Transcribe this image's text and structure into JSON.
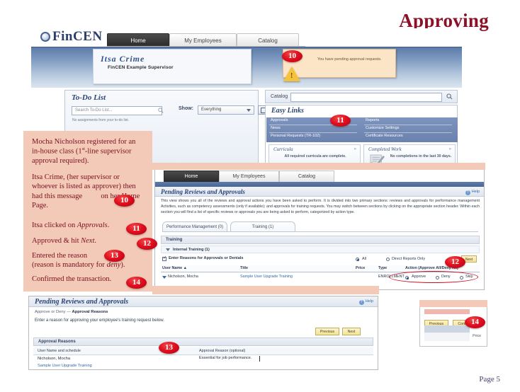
{
  "slide": {
    "title": "Approving",
    "page_label": "Page 5"
  },
  "home_screen": {
    "logo_text": "FinCEN",
    "nav_tabs": [
      {
        "label": "Home",
        "active": true
      },
      {
        "label": "My Employees",
        "active": false
      },
      {
        "label": "Catalog",
        "active": false
      }
    ],
    "user": {
      "name": "Itsa  Crime",
      "role": "FinCEN Example Supervisor"
    },
    "alert": {
      "message": "You have pending approval requests.",
      "icon": "warning-triangle-icon"
    },
    "todo": {
      "title": "To-Do List",
      "search_placeholder": "Search To-Do List...",
      "empty_text": "No assignments from your to-do list.",
      "show_label": "Show:",
      "show_value": "Everything",
      "view_buttons": [
        "list-view",
        "grid-view"
      ]
    },
    "catalog": {
      "label": "Catalog",
      "search_value": ""
    },
    "easy_links": {
      "title": "Easy Links",
      "left_column": [
        "Approvals",
        "News",
        "Personal Requests (TR-102)"
      ],
      "right_column": [
        "Reports",
        "Customize Settings",
        "Certificate Resources"
      ]
    },
    "cards": [
      {
        "title": "Curricula",
        "body": "All required curricula are complete.",
        "chevron": "»",
        "icon": null
      },
      {
        "title": "Completed Work",
        "body": "No completions in the last 30 days.",
        "chevron": "»",
        "icon": "completed-check-icon"
      }
    ]
  },
  "pending_screen": {
    "nav_tabs": [
      {
        "label": "Home",
        "active": true
      },
      {
        "label": "My Employees",
        "active": false
      },
      {
        "label": "Catalog",
        "active": false
      }
    ],
    "title": "Pending Reviews and Approvals",
    "help_label": "Help",
    "description": "This view shows you all of the reviews and approval actions you have been asked to perform. It is divided into two primary sections: reviews and approvals for performance management Activities, such as competency assessments (only if available); and approvals for training requests. You may switch between sections by clicking on the appropriate section header. Within each section you will find a list of specific reviews or approvals you are being asked to perform, categorized by action type.",
    "section_tabs": [
      {
        "label": "Performance Management (0)",
        "active": false
      },
      {
        "label": "Training (1)",
        "active": true
      }
    ],
    "training_header": "Training",
    "internal_training": "Internal Training (1)",
    "enter_reasons_label": "Enter Reasons for Approvals or Denials",
    "enter_reasons_checked": true,
    "filters": [
      {
        "label": "All",
        "selected": true
      },
      {
        "label": "Direct Reports Only",
        "selected": false
      }
    ],
    "next_button": "Next",
    "columns": [
      "User Name ▲",
      "Title",
      "Price",
      "Type",
      "Action (Approve All/Deny All)"
    ],
    "rows": [
      {
        "user_name": "Nicholson, Mocha",
        "title": "Sample User Upgrade Training",
        "price": "",
        "type": "ENROLLMENT",
        "actions": [
          {
            "label": "Approve",
            "selected": true
          },
          {
            "label": "Deny",
            "selected": false
          },
          {
            "label": "Skip",
            "selected": false
          }
        ]
      }
    ]
  },
  "reasons_screen": {
    "title": "Pending Reviews and Approvals",
    "help_label": "Help",
    "breadcrumb_prefix": "Approve or Deny — ",
    "breadcrumb_current": "Approval Reasons",
    "instruction": "Enter a reason for approving your employee's training request below.",
    "buttons": {
      "previous": "Previous",
      "next": "Next"
    },
    "section_header": "Approval Reasons",
    "columns": [
      "User Name and schedule",
      "Approval Reason (optional)"
    ],
    "row": {
      "user_name": "Nicholson, Mocha",
      "course": "Sample User Upgrade Training",
      "reason_value": "Essential for job performance."
    }
  },
  "confirm_screen": {
    "buttons": {
      "previous": "Previous",
      "confirm": "Confirm"
    },
    "price_label": "Price"
  },
  "narration": {
    "paragraphs": [
      "Mocha Nicholson registered for an in-house class (1st-line supervisor approval required).",
      "Itsa Crime, (her supervisor or whoever is listed as approver) then had this message on her Home Page.",
      "Itsa clicked on Approvals.",
      "Approved & hit Next.",
      "Entered the reason (reason is mandatory for deny).",
      "Confirmed the transaction."
    ],
    "line1a": "Mocha Nicholson registered for",
    "line1b": "an in-house class (1",
    "line1b_sup": "st",
    "line1c": "-line",
    "line1d": "supervisor approval required).",
    "line2a": "Itsa Crime, (her supervisor or",
    "line2b": "whoever is listed as approver)",
    "line2c": "then had this message",
    "line2d": "on her Home Page.",
    "line3a": "Itsa clicked on ",
    "line3b": "Approvals",
    "line3c": ".",
    "line4a": "Approved & hit ",
    "line4b": "Next",
    "line4c": ".",
    "line5a": "Entered the reason",
    "line5b": "(reason is mandatory for ",
    "line5c": "deny",
    "line5d": ").",
    "line6": "Confirmed the transaction."
  },
  "badges": {
    "b10": "10",
    "b10b": "10",
    "b11": "11",
    "b11b": "11",
    "b12": "12",
    "b12b": "12",
    "b13": "13",
    "b13b": "13",
    "b14": "14",
    "b14b": "14"
  },
  "colors": {
    "accent_red": "#8c1127",
    "badge_red": "#e01020",
    "narration_bg": "#f3c9b7",
    "nav_blue": "#5d7ba8",
    "link_blue": "#2f6ca8"
  }
}
